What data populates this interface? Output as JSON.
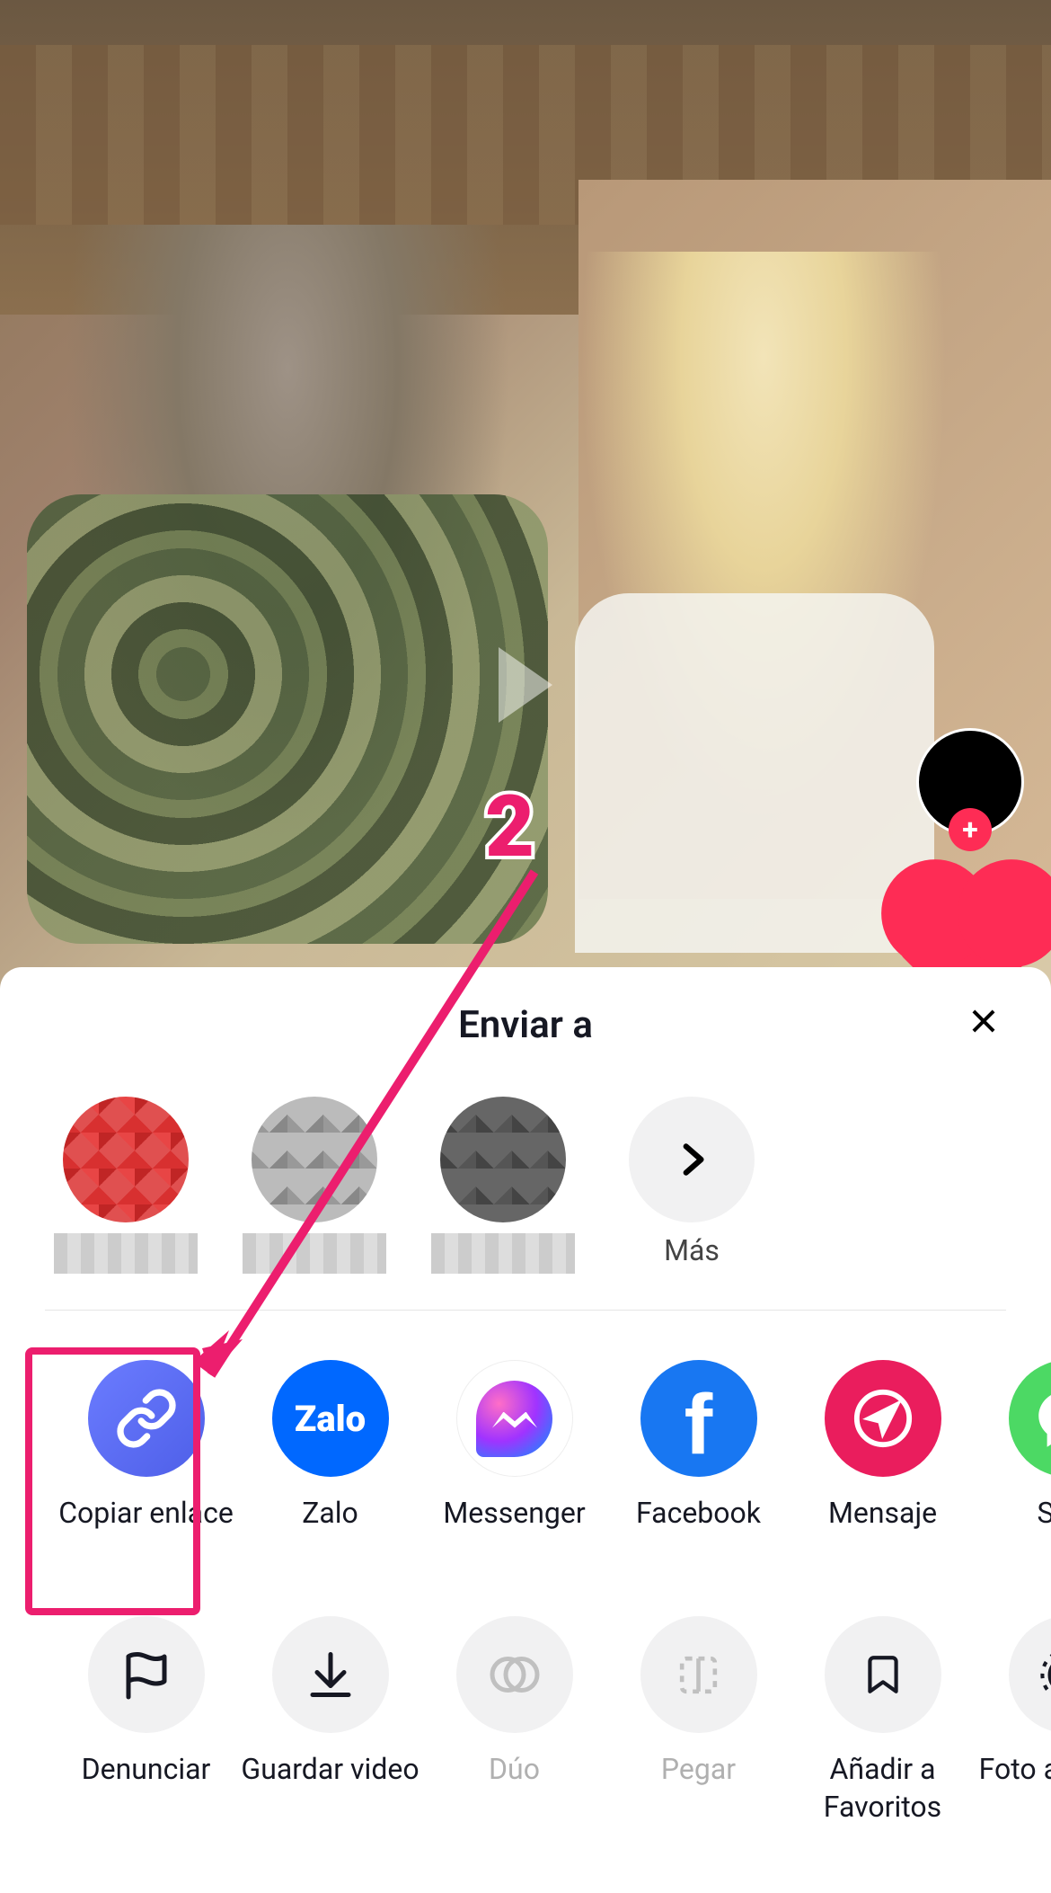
{
  "annotation": {
    "step_number": "2",
    "highlight_color": "#ec1e6e"
  },
  "video_overlay": {
    "right_actions": {
      "follow_plus": "+",
      "like_icon": "heart"
    }
  },
  "share_sheet": {
    "title": "Enviar a",
    "close": "✕",
    "contacts": [
      {
        "name": "",
        "blurred": true
      },
      {
        "name": "",
        "blurred": true
      },
      {
        "name": "",
        "blurred": true
      }
    ],
    "more_label": "Más",
    "share_apps": [
      {
        "label": "Copiar enlace",
        "icon": "link",
        "color": "#5b6df0"
      },
      {
        "label": "Zalo",
        "icon": "zalo",
        "color": "#0068ff"
      },
      {
        "label": "Messenger",
        "icon": "messenger",
        "color": "#ffffff"
      },
      {
        "label": "Facebook",
        "icon": "facebook",
        "color": "#1877f2"
      },
      {
        "label": "Mensaje",
        "icon": "mensaje",
        "color": "#ea1d5d"
      },
      {
        "label": "SMS",
        "icon": "sms",
        "color": "#4cd964"
      }
    ],
    "actions": [
      {
        "label": "Denunciar",
        "icon": "flag",
        "enabled": true
      },
      {
        "label": "Guardar video",
        "icon": "download",
        "enabled": true
      },
      {
        "label": "Dúo",
        "icon": "duet",
        "enabled": false
      },
      {
        "label": "Pegar",
        "icon": "stitch",
        "enabled": false
      },
      {
        "label": "Añadir a Favoritos",
        "icon": "bookmark",
        "enabled": true
      },
      {
        "label": "Foto animada",
        "icon": "livephoto",
        "enabled": true
      }
    ]
  }
}
